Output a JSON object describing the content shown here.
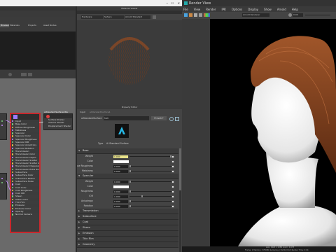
{
  "hypershade": {
    "window_title": "",
    "top_tabs": [
      "Browser",
      "Materials",
      "Lights",
      "Cameras",
      "Shading Groups",
      "Textures",
      "Utilities",
      "Rendering",
      "Projects",
      "Asset Nodes"
    ],
    "material_viewer": {
      "title": "Material Viewer",
      "renderer": "Hardware",
      "shape": "Sphere",
      "env": "Arnold Standard"
    },
    "node_editor": {
      "node_name": "aiStandardSurface1",
      "attrs": [
        "Input",
        "Base Color",
        "Diffuse Roughness",
        "Metalness",
        "Specular",
        "Specular Color",
        "Specular Roughness",
        "Specular IOR",
        "Specular Anisotropy",
        "Specular Rotation",
        "Transmission",
        "Transmission Color",
        "Transmission Depth",
        "Transmission Scatter",
        "Transmission Scatter Aniso",
        "Transmission Dispersion",
        "Transmission Extra Roughness",
        "Subsurface",
        "Subsurface Color",
        "Subsurface Radius",
        "Subsurface Scale",
        "Coat",
        "Coat Color",
        "Coat Roughness",
        "Coat IOR",
        "Sheen",
        "Sheen Color",
        "Thin Film",
        "Emission",
        "Emission Color",
        "Opacity",
        "Normal Camera"
      ],
      "sg_node_name": "aiStandardSurface1SG",
      "sg_attrs": [
        "Surface Shader",
        "Volume Shader",
        "Displacement Shader"
      ]
    },
    "property_editor": {
      "title": "Property Editor",
      "tabs": [
        "Input",
        "aiStandardSurface1"
      ],
      "shader_label": "aiStandardSurface",
      "shader_name": "hair",
      "presets_label": "Presets*",
      "type_label": "Type",
      "type_value": "Ai Standard Surface",
      "sections": {
        "base": "Base",
        "specular": "Specular",
        "transmission": "Transmission",
        "subsurface": "Subsurface",
        "coat": "Coat",
        "sheen": "Sheen",
        "emission": "Emission",
        "thin_film": "Thin Film",
        "geometry": "Geometry"
      },
      "base_rows": [
        {
          "label": "Weight",
          "value": "1.000",
          "slider": 1.0
        },
        {
          "label": "Color",
          "value": "",
          "slider": null
        },
        {
          "label": "Diffuse Roughness",
          "value": "0.000",
          "slider": 0.0
        },
        {
          "label": "Metalness",
          "value": "0.000",
          "slider": 0.0
        }
      ],
      "spec_rows": [
        {
          "label": "Weight",
          "value": "0.000",
          "slider": 0.0
        },
        {
          "label": "Color",
          "value": "",
          "slider": null
        },
        {
          "label": "Roughness",
          "value": "0.000",
          "slider": 0.0
        },
        {
          "label": "IOR",
          "value": "1.000",
          "slider": 0.3
        },
        {
          "label": "Anisotropy",
          "value": "0.000",
          "slider": 0.0
        },
        {
          "label": "Rotation",
          "value": "0.000",
          "slider": 0.0
        }
      ]
    }
  },
  "render_view": {
    "title": "Render View",
    "menu": [
      "File",
      "View",
      "Render",
      "IPR",
      "Options",
      "Display",
      "Show",
      "Arnold",
      "Help"
    ],
    "renderer": "Arnold Renderer",
    "exposure": "0.00",
    "status": "size: 1920 x 1080 zoom: 0.473",
    "status2": "Frame: 1   Memory: 3780Mb   Sampling: [3/2/2/2/2/2]   Render Time: 0:04"
  },
  "colors": {
    "accent_red": "#c8282d",
    "render_bg": "#000000",
    "hair": "#7a3b1a"
  }
}
